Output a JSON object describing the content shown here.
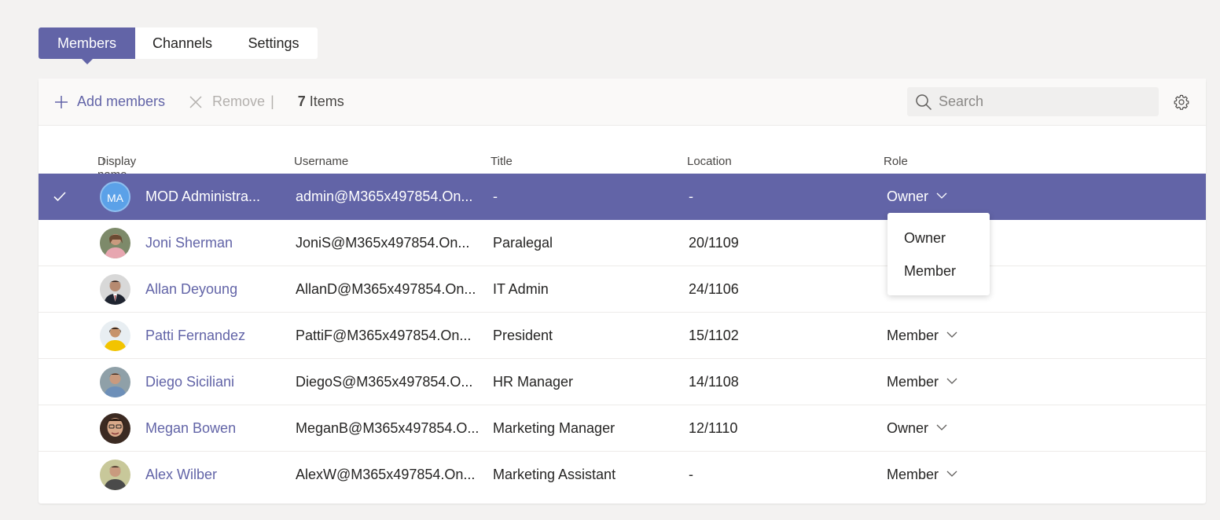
{
  "tabs": [
    "Members",
    "Channels",
    "Settings"
  ],
  "toolbar": {
    "add_label": "Add members",
    "remove_label": "Remove",
    "separator": "|",
    "count_number": "7",
    "count_label": "Items",
    "search_placeholder": "Search"
  },
  "columns": {
    "display_name": "Display name",
    "sort_arrow": "↑",
    "username": "Username",
    "title": "Title",
    "location": "Location",
    "role": "Role"
  },
  "members": [
    {
      "initials": "MA",
      "name": "MOD Administra...",
      "username": "admin@M365x497854.On...",
      "title": "-",
      "location": "-",
      "role": "Owner",
      "selected": true
    },
    {
      "name": "Joni Sherman",
      "username": "JoniS@M365x497854.On...",
      "title": "Paralegal",
      "location": "20/1109",
      "role": ""
    },
    {
      "name": "Allan Deyoung",
      "username": "AllanD@M365x497854.On...",
      "title": "IT Admin",
      "location": "24/1106",
      "role": ""
    },
    {
      "name": "Patti Fernandez",
      "username": "PattiF@M365x497854.On...",
      "title": "President",
      "location": "15/1102",
      "role": "Member"
    },
    {
      "name": "Diego Siciliani",
      "username": "DiegoS@M365x497854.O...",
      "title": "HR Manager",
      "location": "14/1108",
      "role": "Member"
    },
    {
      "name": "Megan Bowen",
      "username": "MeganB@M365x497854.O...",
      "title": "Marketing Manager",
      "location": "12/1110",
      "role": "Owner"
    },
    {
      "name": "Alex Wilber",
      "username": "AlexW@M365x497854.On...",
      "title": "Marketing Assistant",
      "location": "-",
      "role": "Member"
    }
  ],
  "role_dropdown": [
    "Owner",
    "Member"
  ],
  "colors": {
    "accent": "#6264a7",
    "background": "#f3f2f1"
  }
}
